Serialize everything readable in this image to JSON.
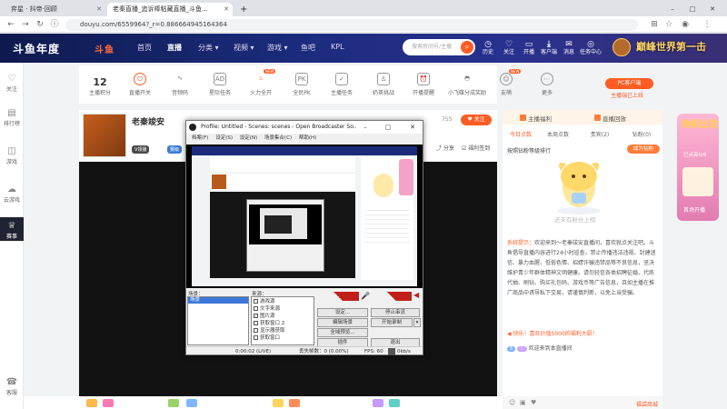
{
  "browser": {
    "tabs": [
      {
        "label": "弈星 · 抖帝·回顾",
        "active": false
      },
      {
        "label": "老秦直播_追诉棒粘藏直播_斗鱼...",
        "active": true
      }
    ],
    "new_tab": "+",
    "url": "douyu.com/6559964?_r=0.886664945164364",
    "nav": {
      "back": "←",
      "forward": "→",
      "reload": "↻"
    },
    "controls": {
      "min": "–",
      "max": "□",
      "close": "✕"
    }
  },
  "header": {
    "logo": "斗鱼年度",
    "logo2": "斗鱼",
    "nav": [
      {
        "label": "首页",
        "selected": false
      },
      {
        "label": "直播",
        "selected": true
      },
      {
        "label": "分类 ▾",
        "selected": false
      },
      {
        "label": "视频 ▾",
        "selected": false
      },
      {
        "label": "游戏 ▾",
        "selected": false
      },
      {
        "label": "鱼吧",
        "selected": false
      },
      {
        "label": "KPL",
        "selected": false
      }
    ],
    "search_placeholder": "搜索房间号/主播",
    "icons": [
      {
        "label": "历史",
        "glyph": "◷"
      },
      {
        "label": "关注",
        "glyph": "♡"
      },
      {
        "label": "开播",
        "glyph": "▭"
      },
      {
        "label": "客户端",
        "glyph": "⤓"
      },
      {
        "label": "消息",
        "glyph": "✉"
      },
      {
        "label": "任务中心",
        "glyph": "◎"
      }
    ],
    "banner": "巅峰世界第一击"
  },
  "left_sidebar": [
    {
      "label": "关注",
      "glyph": "♡"
    },
    {
      "label": "排行榜",
      "glyph": "▤"
    },
    {
      "label": "游戏",
      "glyph": "◫"
    },
    {
      "label": "云游戏",
      "glyph": "☁"
    },
    {
      "label": "赛事",
      "glyph": "♕",
      "active": true
    },
    {
      "label": "客服",
      "glyph": "☎"
    }
  ],
  "toolbar": {
    "anchor_level_value": "12",
    "anchor_level_label": "主播积分",
    "items": [
      {
        "label": "直播开关",
        "glyph": "⏻"
      },
      {
        "label": "音频码",
        "glyph": "∿"
      },
      {
        "label": "星际任务",
        "glyph": "AD"
      },
      {
        "label": "火力全开",
        "glyph": "♨",
        "new": true
      },
      {
        "label": "全民PK",
        "glyph": "PK"
      },
      {
        "label": "主播任务",
        "glyph": "✓"
      },
      {
        "label": "奶茶挑战",
        "glyph": "♙"
      },
      {
        "label": "开播提醒",
        "glyph": "⏰"
      },
      {
        "label": "小飞碟分成奖励",
        "glyph": "◓"
      },
      {
        "label": "友萌",
        "glyph": "☺",
        "new": true
      },
      {
        "label": "更多",
        "glyph": "⋯"
      }
    ],
    "new_badge": "NEW",
    "pc_button": "PC客户端",
    "pc_sub": "主播端已上线"
  },
  "room": {
    "name": "老秦竣安",
    "tag1": "V领播",
    "tag2": "赛级",
    "follow": "关注",
    "follow_count": "755",
    "share": "分享",
    "report": "福利签到"
  },
  "obs": {
    "title": "Profile: Untitled - Scenes: scenes - Open Broadcaster So...",
    "menu": [
      "档案(F)",
      "设定(S)",
      "设定(N)",
      "场景集合(C)",
      "帮助(H)"
    ],
    "scenes_label": "场景：",
    "scenes": [
      "场景"
    ],
    "sources_label": "来源：",
    "sources": [
      {
        "label": "游戏源",
        "checked": false
      },
      {
        "label": "文字来源",
        "checked": false
      },
      {
        "label": "图片源",
        "checked": true
      },
      {
        "label": "获取窗口 2",
        "checked": false
      },
      {
        "label": "显示器获取",
        "checked": false
      },
      {
        "label": "获取窗口",
        "checked": false
      }
    ],
    "buttons": {
      "settings": "设定...",
      "stop_stream": "停止串流",
      "edit_scene": "编辑场景",
      "start_record": "开始录制",
      "fullscreen": "全域预览...",
      "plugins": "插件",
      "exit": "退出"
    },
    "status": {
      "time": "0:00:02 (LIVE)",
      "dropped": "丢失帧数：0 (0.00%)",
      "fps": "FPS: 60",
      "bitrate": "0kb/s"
    }
  },
  "right_panel": {
    "tabs": [
      {
        "label": "主播福利"
      },
      {
        "label": "直播回放"
      }
    ],
    "rank_tabs": [
      "今日点数",
      "本周点数",
      "贵宾(2)",
      "钻粉(0)"
    ],
    "rank_title": "按照钻粉等级排行",
    "power_button": "成为钻粉",
    "empty_caption": "还未有粉丝上榜",
    "system_label": "系统提示：",
    "system_notice": "欢迎来到～老秦竣安直播间，喜欢就点关注吧。斗鱼倡导直播内容进行24小时巡查，禁止传播违法违规、封建迷信、暴力血腥、低俗色情、招嫖诈骗违禁品等不良信息，坚决维护青少年群体精神文明健康。请勿轻信各类招聘征婚、代练代抽、刷钻、购买礼包码、游戏币等广告信息，且如主播在推广商品中诱导私下交易，请谨慎判断，以免上当受骗。",
    "news_label": "快乐！喜欢价值5000的福利大厨！",
    "chat_level": "5",
    "chat_welcome": "欢迎来到本直播间",
    "gift_link": "福袋商城"
  },
  "promo": {
    "title": "扬帆出发",
    "sub": "已点亮0/6",
    "bottom": "首场开播"
  }
}
